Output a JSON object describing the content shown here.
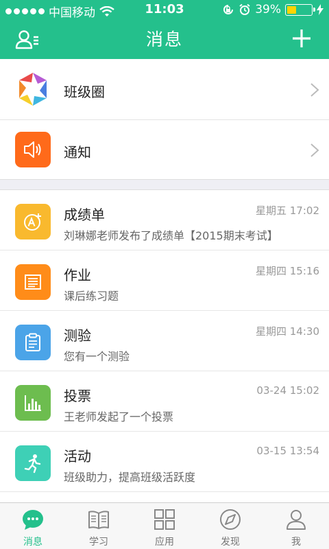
{
  "status_bar": {
    "carrier": "中国移动",
    "time": "11:03",
    "battery": "39%",
    "battery_level": 0.39
  },
  "header": {
    "title": "消息",
    "left_icon": "contacts-icon",
    "right_icon": "plus-icon"
  },
  "top_items": [
    {
      "label": "班级圈",
      "icon": "class-circle-icon"
    },
    {
      "label": "通知",
      "icon": "speaker-icon",
      "color": "#ff6a1a"
    }
  ],
  "messages": [
    {
      "title": "成绩单",
      "time": "星期五  17:02",
      "subtitle": "刘琳娜老师发布了成绩单【2015期末考试】",
      "icon": "grade-icon",
      "color": "#f9b92e"
    },
    {
      "title": "作业",
      "time": "星期四  15:16",
      "subtitle": "课后练习题",
      "icon": "homework-icon",
      "color": "#ff8c19"
    },
    {
      "title": "测验",
      "time": "星期四  14:30",
      "subtitle": "您有一个测验",
      "icon": "quiz-icon",
      "color": "#4ba4e8"
    },
    {
      "title": "投票",
      "time": "03-24  15:02",
      "subtitle": "王老师发起了一个投票",
      "icon": "vote-icon",
      "color": "#6dbd4f"
    },
    {
      "title": "活动",
      "time": "03-15  13:54",
      "subtitle": "班级助力，提高班级活跃度",
      "icon": "activity-icon",
      "color": "#3ed0b6"
    }
  ],
  "tabs": [
    {
      "label": "消息",
      "icon": "message-icon",
      "active": true
    },
    {
      "label": "学习",
      "icon": "book-icon",
      "active": false
    },
    {
      "label": "应用",
      "icon": "apps-icon",
      "active": false
    },
    {
      "label": "发现",
      "icon": "compass-icon",
      "active": false
    },
    {
      "label": "我",
      "icon": "profile-icon",
      "active": false
    }
  ],
  "colors": {
    "accent": "#24c08c",
    "tab_inactive": "#777777"
  }
}
